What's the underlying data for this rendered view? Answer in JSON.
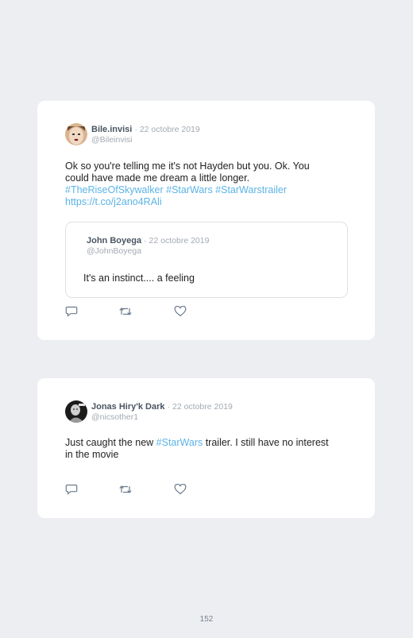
{
  "tweets": [
    {
      "author": "Bile.invisi",
      "date": "· 22 octobre 2019",
      "handle": "@Bileinvisi",
      "text_line1": "Ok so you're telling me it's not Hayden but you. Ok. You",
      "text_line2": "could have made me dream a little longer.",
      "hashtags": "#TheRiseOfSkywalker #StarWars #StarWarstrailer",
      "link": "https://t.co/j2ano4RAli",
      "quote": {
        "author": "John Boyega",
        "date": "· 22 octobre 2019",
        "handle": "@JohnBoyega",
        "text": "It's an instinct.... a feeling"
      }
    },
    {
      "author": "Jonas Hiry'k Dark",
      "date": "· 22 octobre 2019",
      "handle": "@nicsother1",
      "text_before": "Just caught the new ",
      "hashtag": "#StarWars",
      "text_after": " trailer. I still have no interest",
      "text_line2": "in the movie"
    }
  ],
  "icons": [
    "reply-icon",
    "retweet-icon",
    "like-icon"
  ],
  "page_number": "152"
}
